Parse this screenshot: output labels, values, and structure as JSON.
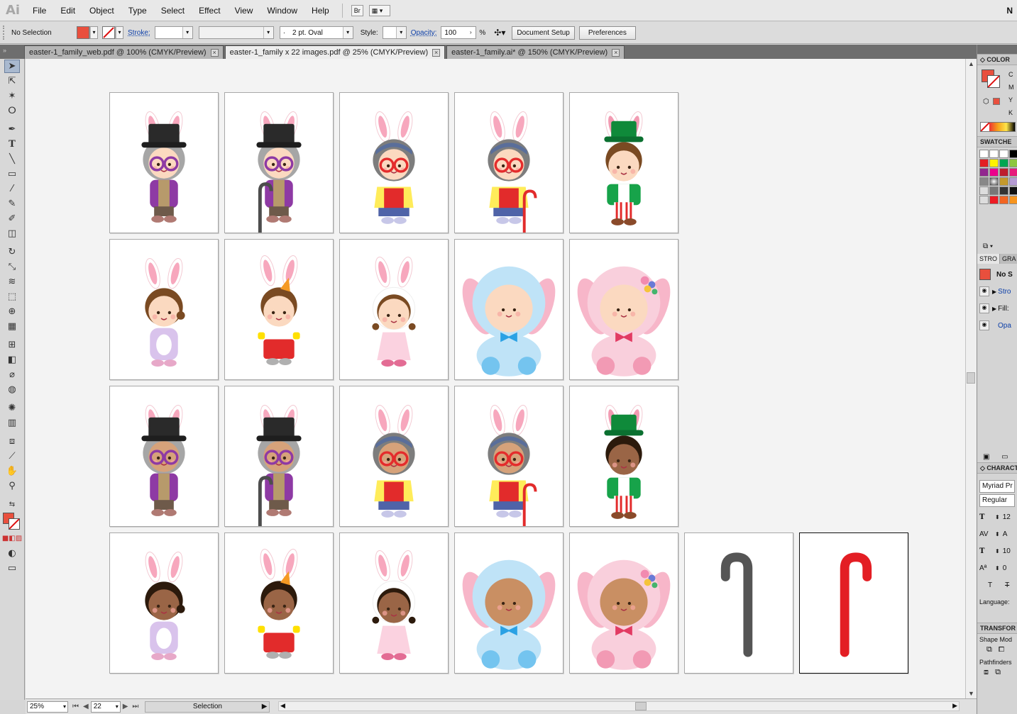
{
  "app": {
    "logo": "Ai"
  },
  "menu": [
    "File",
    "Edit",
    "Object",
    "Type",
    "Select",
    "Effect",
    "View",
    "Window",
    "Help"
  ],
  "menubar_right_label": "N",
  "menubar_btn_bridge": "Br",
  "control": {
    "selection_label": "No Selection",
    "stroke_label": "Stroke:",
    "brush_value": "2 pt. Oval",
    "brush_dot": "·",
    "style_label": "Style:",
    "opacity_label": "Opacity:",
    "opacity_value": "100",
    "percent": "%",
    "document_setup": "Document Setup",
    "preferences": "Preferences",
    "fill_color": "#e94f3d"
  },
  "tabs": [
    {
      "label": "easter-1_family_web.pdf @ 100% (CMYK/Preview)",
      "active": false
    },
    {
      "label": "easter-1_family x 22 images.pdf @ 25% (CMYK/Preview)",
      "active": true
    },
    {
      "label": "easter-1_family.ai* @ 150% (CMYK/Preview)",
      "active": false
    }
  ],
  "status": {
    "zoom": "25%",
    "artboard_number": "22",
    "tool_name": "Selection"
  },
  "panels": {
    "color": {
      "title": "COLOR",
      "c": "C",
      "m": "M",
      "y": "Y",
      "k": "K"
    },
    "swatches": {
      "title": "SWATCHE"
    },
    "stroke_tabs": [
      "STRO",
      "GRA"
    ],
    "appearance": {
      "no_selection": "No S",
      "stroke": "Stro",
      "fill": "Fill:",
      "opacity": "Opa"
    },
    "character": {
      "title": "CHARACT",
      "font": "Myriad Pr",
      "style": "Regular",
      "language": "Language:",
      "size": "12",
      "leading": "A",
      "scale": "10",
      "baseline": "0"
    },
    "transform": {
      "title": "TRANSFOR",
      "shape_modes": "Shape Mod",
      "pathfinders": "Pathfinders"
    }
  },
  "artboards": [
    {
      "char": "grandpa",
      "skin": "light"
    },
    {
      "char": "grandpa-cane",
      "skin": "light"
    },
    {
      "char": "grandma",
      "skin": "light"
    },
    {
      "char": "grandma-cane",
      "skin": "light"
    },
    {
      "char": "dad",
      "skin": "light"
    },
    {
      "char": "mom",
      "skin": "light"
    },
    {
      "char": "boy",
      "skin": "light"
    },
    {
      "char": "girl",
      "skin": "light"
    },
    {
      "char": "baby-blue",
      "skin": "light"
    },
    {
      "char": "baby-pink",
      "skin": "light"
    },
    {
      "char": "grandpa",
      "skin": "medium"
    },
    {
      "char": "grandpa-cane",
      "skin": "medium"
    },
    {
      "char": "grandma",
      "skin": "medium"
    },
    {
      "char": "grandma-cane",
      "skin": "medium"
    },
    {
      "char": "dad",
      "skin": "dark"
    },
    {
      "char": "mom",
      "skin": "dark"
    },
    {
      "char": "boy",
      "skin": "dark"
    },
    {
      "char": "girl",
      "skin": "dark"
    },
    {
      "char": "baby-blue",
      "skin": "tan"
    },
    {
      "char": "baby-pink",
      "skin": "tan"
    },
    {
      "char": "cane-gray",
      "skin": ""
    },
    {
      "char": "cane-red",
      "skin": ""
    }
  ]
}
